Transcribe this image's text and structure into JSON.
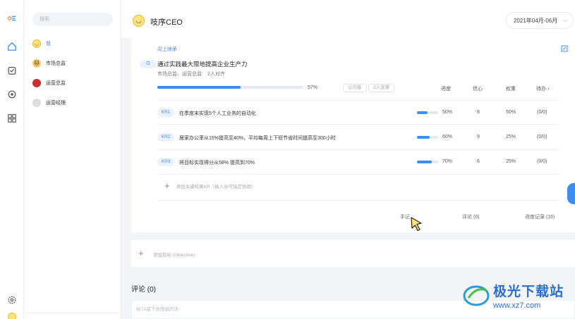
{
  "sidebar": {
    "search_placeholder": "搜索",
    "people": [
      {
        "name": "我",
        "avatar": "smiley"
      },
      {
        "name": "市场总监",
        "avatar": "cat"
      },
      {
        "name": "运营总监",
        "avatar": "red-face"
      },
      {
        "name": "运营经理",
        "avatar": "dog"
      }
    ]
  },
  "header": {
    "title": "吱序CEO",
    "period": "2021年04月-06月"
  },
  "objective": {
    "up_link": "向上映承",
    "badge": "O",
    "title": "通过实践最大限地提高企业生产力",
    "owners": "市场总监、运营总监",
    "aligned": "2人对齐",
    "progress": 57,
    "progress_label": "57%",
    "tag_company": "公司级",
    "tag_support": "2人支撑",
    "col_progress": "进度",
    "col_confidence": "信心",
    "col_weight": "权重",
    "col_todo": "待办 ›"
  },
  "key_results": [
    {
      "badge": "KR1",
      "title": "在季度末实现5个人工业务的自动化",
      "progress": 50,
      "progress_label": "50%",
      "confidence": "8",
      "weight": "50%",
      "todo": "(0/0)"
    },
    {
      "badge": "KR2",
      "title": "居家办公率从15%提高至40%，平均每周上下班节省时间提高至300小时",
      "progress": 60,
      "progress_label": "60%",
      "confidence": "9",
      "weight": "25%",
      "todo": "(0/0)"
    },
    {
      "badge": "KR3",
      "title": "将目标实现得分从58% 提高到70%",
      "progress": 70,
      "progress_label": "70%",
      "confidence": "6",
      "weight": "25%",
      "todo": "(0/0)"
    }
  ],
  "add_kr": "添加关键结果KR（输入@可指定协助）",
  "card_footer": {
    "notes": "手记",
    "comments": "评论 (0)",
    "history": "进度记录 (16)"
  },
  "add_objective": "添加目标 (Objective)",
  "comments_section": {
    "title": "评论 (0)",
    "placeholder": "给TA留下你想说的话~"
  },
  "watermark": {
    "line1": "极光下载站",
    "line2": "www.xz7.com"
  },
  "colors": {
    "accent": "#3f8cf0",
    "background": "#f3f4f7"
  }
}
